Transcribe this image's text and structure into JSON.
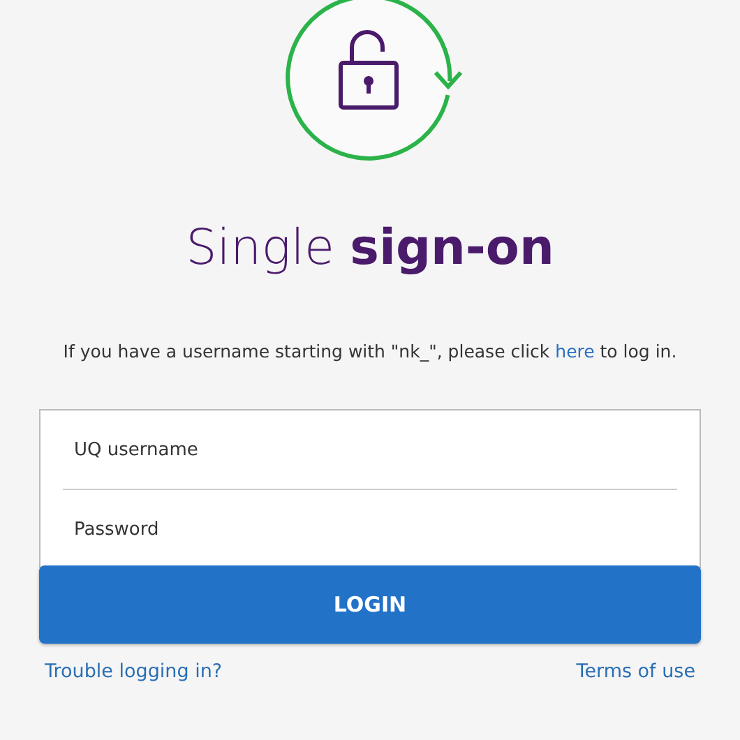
{
  "title": "Single **sign-on**",
  "notice": {
    "before": "If you have a username starting with \"nk_\", please click",
    "link": "here",
    "after": "to log in."
  },
  "fields": [
    {
      "placeholder": "UQ username"
    },
    {
      "placeholder": "Password"
    }
  ],
  "login_button": "LOGIN",
  "links": [
    "Trouble logging in?",
    "Terms of use"
  ]
}
